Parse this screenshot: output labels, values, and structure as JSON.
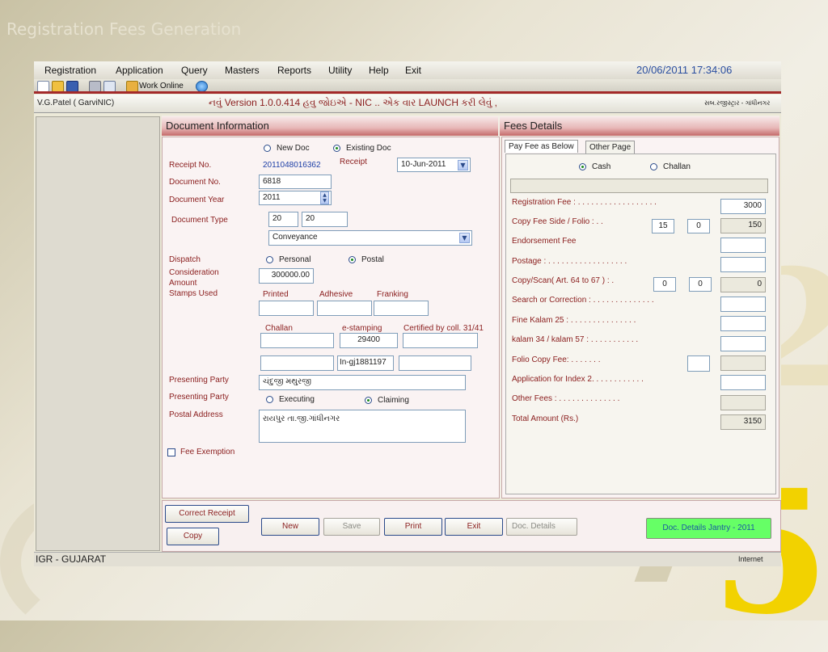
{
  "slide_title": "Registration Fees Generation",
  "menu": [
    "Registration",
    "Application",
    "Query",
    "Masters",
    "Reports",
    "Utility",
    "Help",
    "Exit"
  ],
  "datetime": "20/06/2011 17:34:06",
  "toolbar": {
    "work_online": "Work Online"
  },
  "infobar": {
    "user": "V.G.Patel ( GarviNIC)",
    "version_notice": "નવું Version 1.0.0.414  હવુ જોઇએ  - NIC .. એક વાર LAUNCH  કરી લેવું ,",
    "office": "સબ.રજીસ્ટ્રાર - ગાંધીનગર"
  },
  "doc": {
    "header": "Document Information",
    "new_doc": "New Doc",
    "existing_doc": "Existing Doc",
    "receipt_no_label": "Receipt No.",
    "receipt_no_value": "2011048016362",
    "receipt_label": "Receipt",
    "receipt_date": "10-Jun-2011",
    "document_no_label": "Document No.",
    "document_no_value": "6818",
    "document_year_label": "Document Year",
    "document_year_value": "2011",
    "document_type_label": "Document Type",
    "type_code1": "20",
    "type_code2": "20",
    "type_name": "Conveyance",
    "dispatch_label": "Dispatch",
    "dispatch_personal": "Personal",
    "dispatch_postal": "Postal",
    "consideration_label1": "Consideration",
    "consideration_label2": "Amount",
    "consideration_value": "300000.00",
    "stamps_used_label": "Stamps Used",
    "printed": "Printed",
    "adhesive": "Adhesive",
    "franking": "Franking",
    "challan": "Challan",
    "e_stamping": "e-stamping",
    "certified": "Certified by coll. 31/41",
    "estamp_value": "29400",
    "estamp_cert_no": "In-gj1881197",
    "presenting_party_label": "Presenting Party",
    "presenting_party_value": "ચંદુજી મથુરજી",
    "presenting_party_label2": "Presenting Party",
    "executing": "Executing",
    "claiming": "Claiming",
    "postal_address_label": "Postal Address",
    "postal_address_value": "રાયપુર તા.જી.ગાંધીનગર",
    "fee_exemption": "Fee Exemption"
  },
  "fees": {
    "header": "Fees Details",
    "tab_pay": "Pay Fee as Below",
    "tab_other": "Other Page",
    "cash": "Cash",
    "challan": "Challan",
    "registration_fee_label": "Registration Fee  : . . . . . . . . . . . . . . . . . .",
    "registration_fee_value": "3000",
    "copy_fee_label": "Copy Fee Side / Folio  : . .",
    "copy_side": "15",
    "copy_folio": "0",
    "copy_fee_value": "150",
    "endorsement_label": "Endorsement  Fee",
    "postage_label": "Postage : . . . . . . . . . . . . . . . . . .",
    "copy_scan_label": "Copy/Scan( Art. 64 to 67 ) : .",
    "scan_a": "0",
    "scan_b": "0",
    "scan_value": "0",
    "search_label": "Search or Correction : . . . . . . . . . . . . . .",
    "fine_label": "Fine Kalam 25 : . . . . . . . . . . . . . . .",
    "kalam_label": "kalam 34 / kalam 57 : . . . . . . . . . . .",
    "folio_copy_label": "Folio Copy Fee: . . . . . . .",
    "app_index_label": "Application for Index 2. . . . . . . . . . . .",
    "other_fees_label": "Other Fees : . . . . . . . . . . . . . .",
    "total_label": "Total Amount (Rs.)",
    "total_value": "3150"
  },
  "buttons": {
    "correct_receipt": "Correct Receipt",
    "copy": "Copy",
    "new": "New",
    "save": "Save",
    "print": "Print",
    "exit": "Exit",
    "doc_details": "Doc. Details",
    "doc_details_jantry": "Doc. Details Jantry - 2011"
  },
  "status": {
    "left": "IGR - GUJARAT",
    "right": "Internet"
  }
}
